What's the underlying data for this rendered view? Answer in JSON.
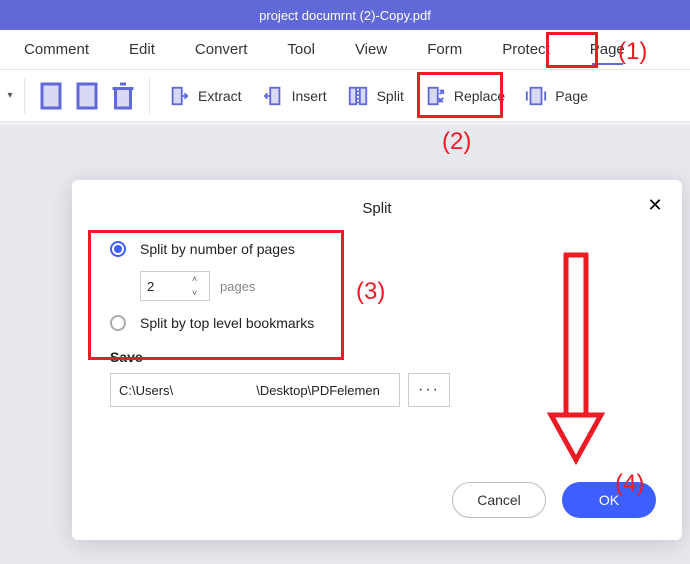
{
  "title": "project documrnt (2)-Copy.pdf",
  "menu": {
    "items": [
      "Comment",
      "Edit",
      "Convert",
      "Tool",
      "View",
      "Form",
      "Protect",
      "Page"
    ],
    "active_index": 7
  },
  "toolbar": {
    "extract": "Extract",
    "insert": "Insert",
    "split": "Split",
    "replace": "Replace",
    "page": "Page"
  },
  "dialog": {
    "title": "Split",
    "opt_pages": "Split by number of pages",
    "opt_bookmarks": "Split by top level bookmarks",
    "spinner_value": "2",
    "spinner_unit": "pages",
    "save_label": "Save",
    "save_path": "C:\\Users\\                       \\Desktop\\PDFelemen",
    "browse": "···",
    "cancel": "Cancel",
    "ok": "OK"
  },
  "annotations": {
    "a1": "(1)",
    "a2": "(2)",
    "a3": "(3)",
    "a4": "(4)"
  }
}
